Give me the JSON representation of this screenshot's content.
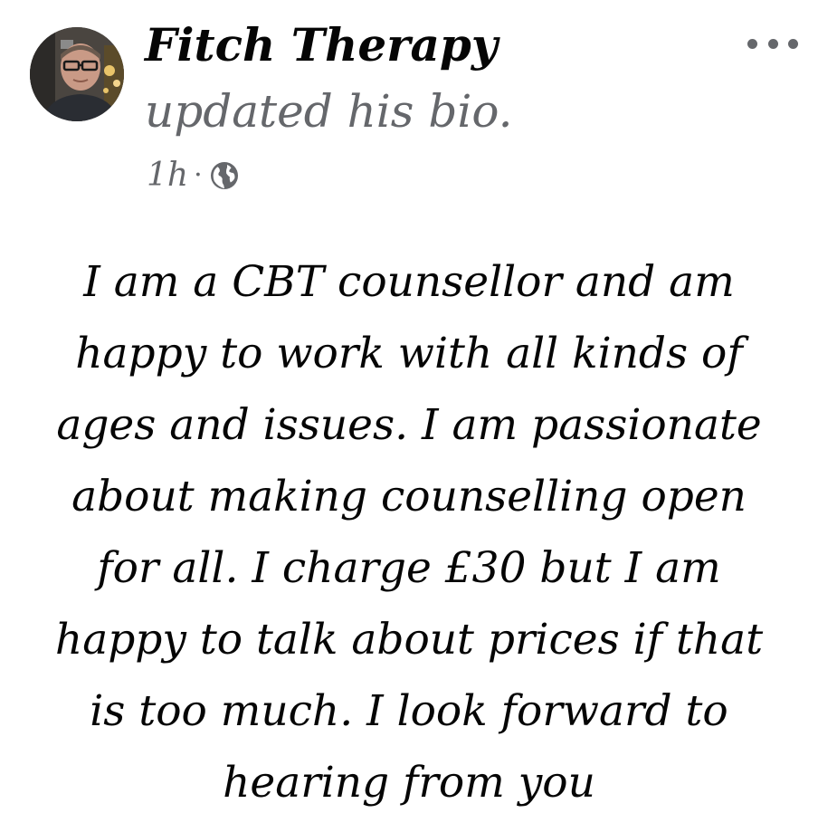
{
  "post": {
    "author_name": "Fitch Therapy",
    "action_text": "updated his bio.",
    "timestamp": "1h",
    "separator": "·",
    "privacy_icon": "globe-icon",
    "more_icon": "more-horizontal-icon",
    "bio_text": "I am a CBT counsellor and am\nhappy to work with all kinds of\nages and issues. I am passionate\nabout making counselling open\nfor all. I charge £30 but I am\nhappy to talk about prices if that\nis too much. I look forward to\nhearing from you"
  },
  "colors": {
    "primary_text": "#050505",
    "secondary_text": "#65676b",
    "background": "#ffffff"
  }
}
